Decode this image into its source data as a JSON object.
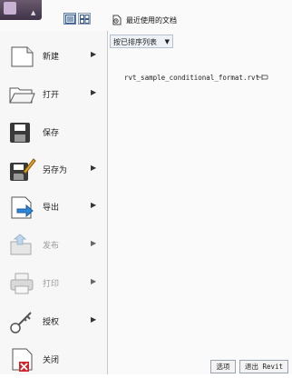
{
  "header": {
    "recent_title": "最近使用的文档",
    "sort_dropdown": "按已排序列表",
    "icon_names": [
      "app-menu-icon",
      "recent-list-view-icon",
      "recent-thumb-view-icon"
    ]
  },
  "menu": {
    "items": [
      {
        "label": "新建",
        "icon": "new-document-icon",
        "has_submenu": true,
        "enabled": true
      },
      {
        "label": "打开",
        "icon": "open-folder-icon",
        "has_submenu": true,
        "enabled": true
      },
      {
        "label": "保存",
        "icon": "save-disk-icon",
        "has_submenu": false,
        "enabled": true
      },
      {
        "label": "另存为",
        "icon": "save-as-icon",
        "has_submenu": true,
        "enabled": true
      },
      {
        "label": "导出",
        "icon": "export-icon",
        "has_submenu": true,
        "enabled": true
      },
      {
        "label": "发布",
        "icon": "publish-icon",
        "has_submenu": true,
        "enabled": false
      },
      {
        "label": "打印",
        "icon": "print-icon",
        "has_submenu": true,
        "enabled": false
      },
      {
        "label": "授权",
        "icon": "license-key-icon",
        "has_submenu": true,
        "enabled": true
      },
      {
        "label": "关闭",
        "icon": "close-document-icon",
        "has_submenu": false,
        "enabled": true
      }
    ]
  },
  "recent": {
    "files": [
      {
        "name": "rvt_sample_conditional_format.rvt",
        "pin_icon": "pin-icon"
      }
    ]
  },
  "footer": {
    "options_label": "选项",
    "exit_label": "退出 Revit"
  },
  "colors": {
    "accent": "#5e7fa8",
    "export_arrow": "#2f86d6",
    "close_badge": "#d0262b",
    "save_as_pencil": "#f0a020"
  }
}
